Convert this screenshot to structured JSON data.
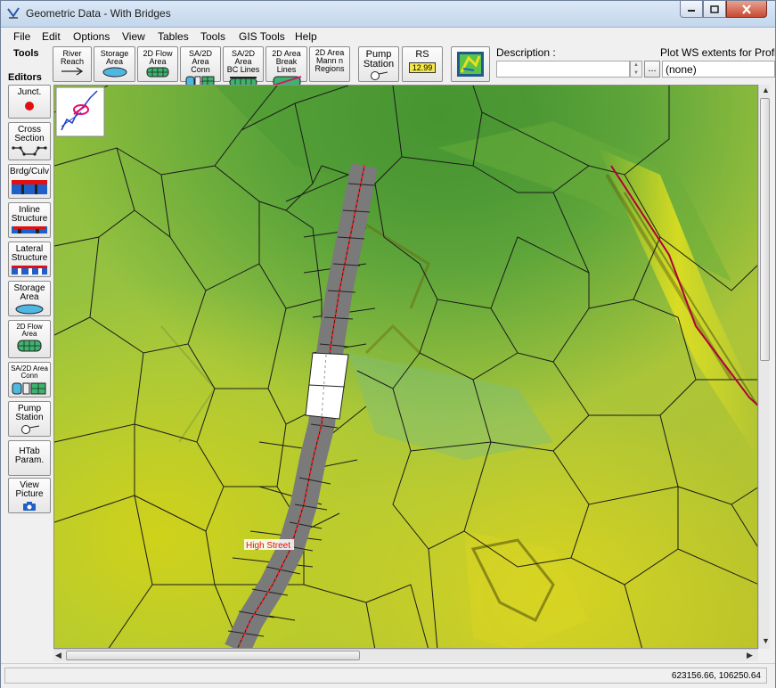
{
  "window": {
    "title": "Geometric Data - With Bridges"
  },
  "menu": [
    "File",
    "Edit",
    "Options",
    "View",
    "Tables",
    "Tools",
    "GIS Tools",
    "Help"
  ],
  "toolbar": {
    "tools_label": "Tools",
    "buttons": [
      {
        "line1": "River",
        "line2": "Reach",
        "icon": "arrow-icon"
      },
      {
        "line1": "Storage",
        "line2": "Area",
        "icon": "storage-area-icon"
      },
      {
        "line1": "2D Flow",
        "line2": "Area",
        "icon": "2d-flow-area-icon"
      },
      {
        "line1": "SA/2D Area",
        "line2": "Conn",
        "icon": "sa-2d-conn-icon"
      },
      {
        "line1": "SA/2D Area",
        "line2": "BC Lines",
        "icon": "bc-lines-icon"
      },
      {
        "line1": "2D Area",
        "line2": "Break Lines",
        "icon": "break-lines-icon"
      },
      {
        "line1": "2D Area",
        "line2": "Mann n",
        "line3": "Regions",
        "icon": "mann-regions-icon"
      },
      {
        "line1": "Pump",
        "line2": "Station",
        "icon": "pump-icon"
      },
      {
        "line1": "RS",
        "line2": "12.99",
        "icon": "rs-icon"
      }
    ],
    "description_label": "Description :",
    "description_value": "",
    "plot_label": "Plot WS extents for Profile:",
    "plot_value": "(none)",
    "ellipsis": "..."
  },
  "editors": {
    "label": "Editors",
    "buttons": [
      {
        "line1": "Junct.",
        "icon": "junction-icon"
      },
      {
        "line1": "Cross",
        "line2": "Section",
        "icon": "cross-section-icon"
      },
      {
        "line1": "Brdg/Culv",
        "icon": "bridge-icon"
      },
      {
        "line1": "Inline",
        "line2": "Structure",
        "icon": "inline-structure-icon"
      },
      {
        "line1": "Lateral",
        "line2": "Structure",
        "icon": "lateral-structure-icon"
      },
      {
        "line1": "Storage",
        "line2": "Area",
        "icon": "storage-area-icon"
      },
      {
        "line1": "2D Flow",
        "line2": "Area",
        "icon": "2d-flow-area-icon"
      },
      {
        "line1": "SA/2D Area",
        "line2": "Conn",
        "icon": "sa-2d-conn-icon"
      },
      {
        "line1": "Pump",
        "line2": "Station",
        "icon": "pump-icon"
      },
      {
        "line1": "HTab",
        "line2": "Param.",
        "icon": ""
      },
      {
        "line1": "View",
        "line2": "Picture",
        "icon": "camera-icon"
      }
    ]
  },
  "map": {
    "road_label": "High Street"
  },
  "status": {
    "coordinates": "623156.66, 106250.64"
  },
  "colors": {
    "road_centerline": "#ff0000",
    "river": "#b0003a",
    "mesh_line": "#1a1a1a",
    "terrain_low": "#9ec84e",
    "terrain_high": "#3f8e2b"
  }
}
